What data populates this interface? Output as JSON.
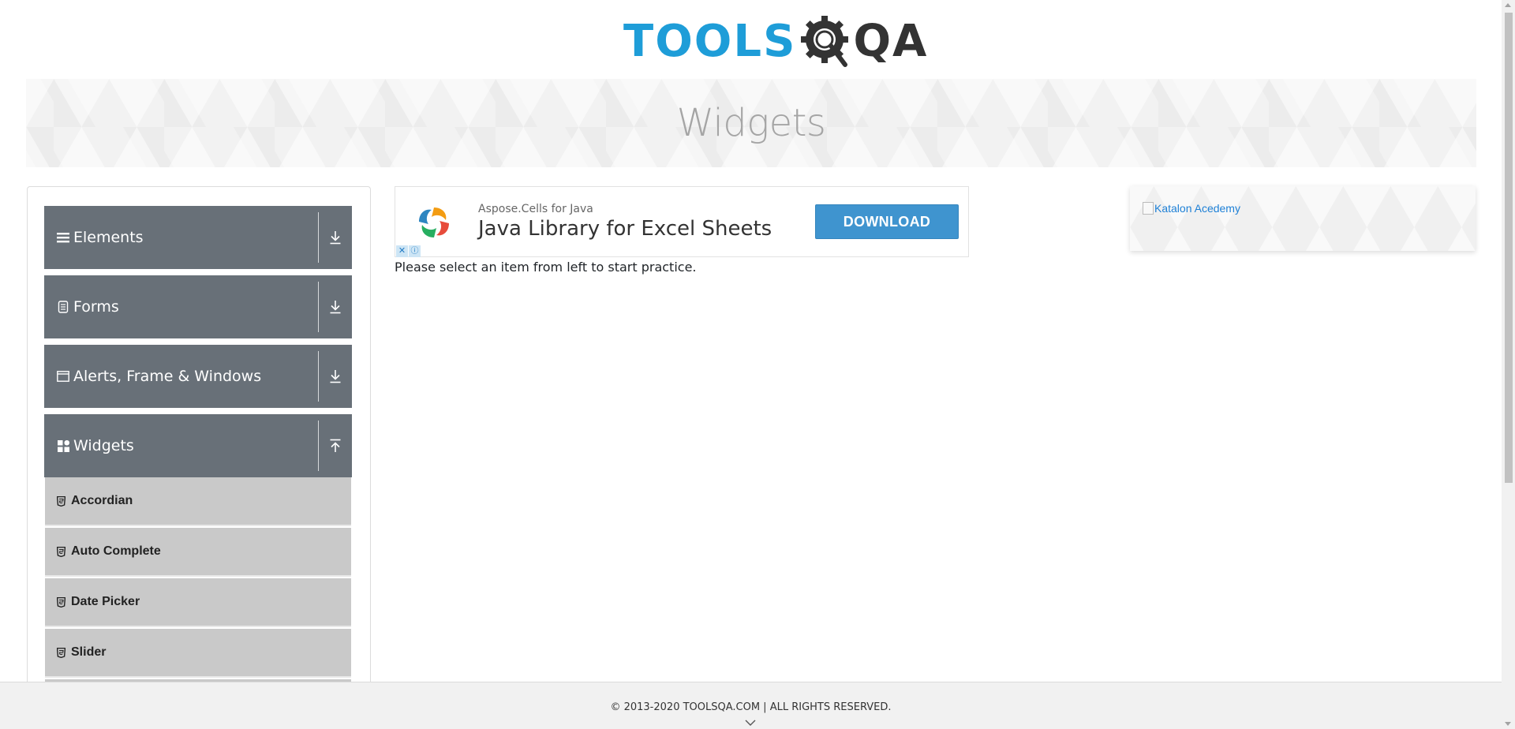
{
  "header": {
    "logo_tools": "TOOLS",
    "logo_qa": "QA",
    "logo_colors": {
      "tools": "#1e9dd8",
      "qa": "#333333"
    }
  },
  "banner": {
    "title": "Widgets"
  },
  "sidebar": {
    "groups": [
      {
        "label": "Elements",
        "icon": "menu-icon",
        "arrow": "download-arrow-icon"
      },
      {
        "label": "Forms",
        "icon": "form-icon",
        "arrow": "download-arrow-icon"
      },
      {
        "label": "Alerts, Frame & Windows",
        "icon": "window-icon",
        "arrow": "download-arrow-icon"
      },
      {
        "label": "Widgets",
        "icon": "grid-icon",
        "arrow": "upload-arrow-icon",
        "expanded": true
      }
    ],
    "widget_items": [
      {
        "label": "Accordian",
        "icon": "html5-icon"
      },
      {
        "label": "Auto Complete",
        "icon": "html5-icon"
      },
      {
        "label": "Date Picker",
        "icon": "html5-icon"
      },
      {
        "label": "Slider",
        "icon": "html5-icon"
      }
    ],
    "colors": {
      "group_bg": "#687078",
      "item_bg": "#c9c9c9"
    }
  },
  "ad": {
    "subtitle": "Aspose.Cells for Java",
    "title": "Java Library for Excel Sheets",
    "button_label": "DOWNLOAD",
    "close_label": "✕",
    "info_label": "ⓘ",
    "button_color": "#3f94cf"
  },
  "main": {
    "instruction": "Please select an item from left to start practice."
  },
  "right_ad": {
    "alt_text": "Katalon Acedemy"
  },
  "footer": {
    "text": "© 2013-2020 TOOLSQA.COM | ALL RIGHTS RESERVED."
  }
}
